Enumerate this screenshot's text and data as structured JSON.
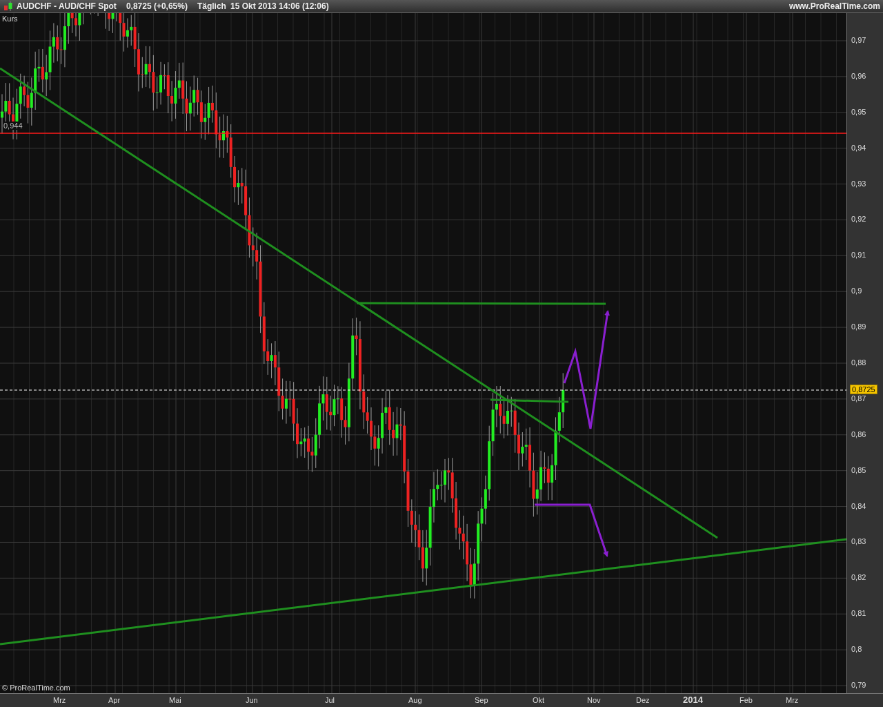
{
  "header": {
    "symbol": "AUDCHF - AUD/CHF Spot",
    "price": "0,8725 (+0,65%)",
    "period": "Täglich",
    "datetime": "15 Okt 2013 14:06 (12:06)",
    "website": "www.ProRealTime.com"
  },
  "chart": {
    "series_label": "Kurs",
    "level_label": "0,944",
    "price_badge": "0,8725",
    "copyright": "© ProRealTime.com",
    "y_ticks": [
      "0,97",
      "0,96",
      "0,95",
      "0,94",
      "0,93",
      "0,92",
      "0,91",
      "0,9",
      "0,89",
      "0,88",
      "0,87",
      "0,86",
      "0,85",
      "0,84",
      "0,83",
      "0,82",
      "0,81",
      "0,8",
      "0,79"
    ],
    "x_ticks": [
      {
        "label": "Mrz",
        "kind": "month"
      },
      {
        "label": "Apr",
        "kind": "month"
      },
      {
        "label": "Mai",
        "kind": "month"
      },
      {
        "label": "Jun",
        "kind": "month"
      },
      {
        "label": "Jul",
        "kind": "month"
      },
      {
        "label": "Aug",
        "kind": "month"
      },
      {
        "label": "Sep",
        "kind": "month"
      },
      {
        "label": "Okt",
        "kind": "month"
      },
      {
        "label": "Nov",
        "kind": "month"
      },
      {
        "label": "Dez",
        "kind": "month"
      },
      {
        "label": "2014",
        "kind": "year"
      },
      {
        "label": "Feb",
        "kind": "month"
      },
      {
        "label": "Mrz",
        "kind": "month"
      }
    ]
  }
}
